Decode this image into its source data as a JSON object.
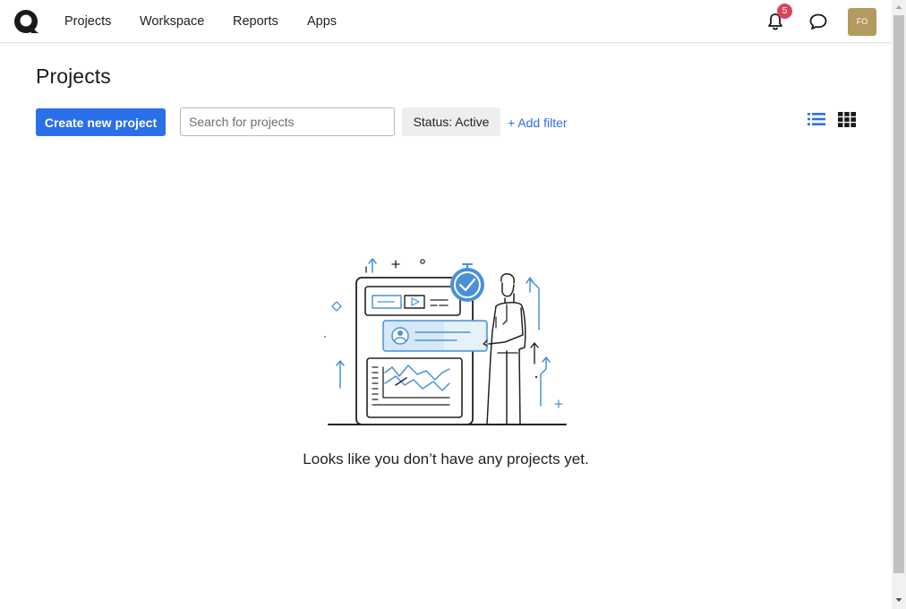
{
  "nav": {
    "items": [
      {
        "label": "Projects"
      },
      {
        "label": "Workspace"
      },
      {
        "label": "Reports"
      },
      {
        "label": "Apps"
      }
    ],
    "notifications_count": "5",
    "avatar_initials": "FO"
  },
  "page": {
    "title": "Projects",
    "create_button_label": "Create new project",
    "search_placeholder": "Search for projects",
    "status_filter_label": "Status: Active",
    "add_filter_label": "+ Add filter",
    "empty_message": "Looks like you don’t have any projects yet."
  },
  "icons": [
    "logo-icon",
    "bell-icon",
    "chat-icon",
    "list-view-icon",
    "grid-view-icon"
  ],
  "colors": {
    "primary": "#2b6fe8",
    "badge": "#d9455b",
    "avatar_bg": "#b39a5f",
    "illustration_accent": "#4a90d9"
  }
}
